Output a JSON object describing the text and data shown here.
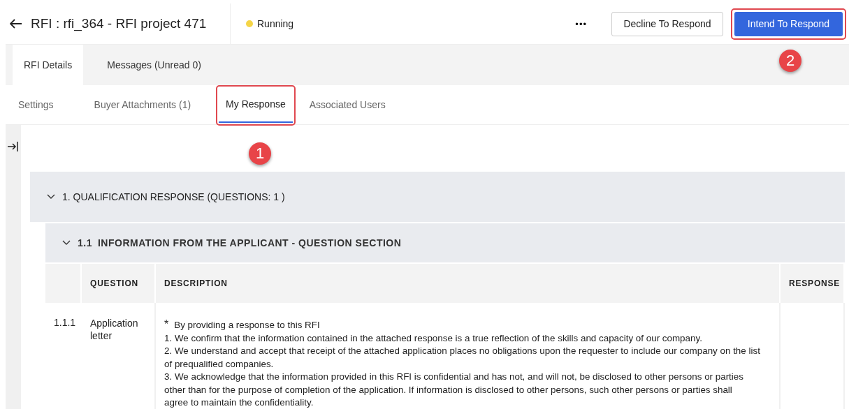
{
  "header": {
    "title": "RFI : rfi_364 - RFI project 471",
    "status": {
      "label": "Running",
      "color": "#f5d547"
    },
    "more": "•••",
    "buttons": [
      {
        "label": "Decline To Respond",
        "kind": "secondary",
        "highlighted": false
      },
      {
        "label": "Intend To Respond",
        "kind": "primary",
        "highlighted": true
      }
    ]
  },
  "tabs": [
    {
      "label": "RFI Details",
      "selected": true
    },
    {
      "label": "Messages (Unread 0)",
      "selected": false
    }
  ],
  "subtabs": [
    {
      "label": "Settings",
      "selected": false,
      "highlighted": false
    },
    {
      "label": "Buyer Attachments (1)",
      "selected": false,
      "highlighted": false
    },
    {
      "label": "My Response",
      "selected": true,
      "highlighted": true
    },
    {
      "label": "Associated Users",
      "selected": false,
      "highlighted": false
    }
  ],
  "callouts": [
    "1",
    "2"
  ],
  "section": {
    "title": "1. QUALIFICATION RESPONSE (QUESTIONS: 1 )",
    "expanded": true,
    "subsection": {
      "number": "1.1",
      "title": "INFORMATION FROM THE APPLICANT - QUESTION SECTION",
      "expanded": true,
      "columns": [
        "QUESTION",
        "DESCRIPTION",
        "RESPONSE"
      ],
      "rows": [
        {
          "number": "1.1.1",
          "question": "Application letter",
          "required": "*",
          "lead": "By providing a response to this RFI",
          "lines": [
            "1. We confirm that the information contained in the attached response is a true reflection of the skills and capacity of our company.",
            "2. We understand and accept that receipt of the attached application places no obligations upon the requester to include our company on the list",
            "of prequalified companies.",
            "3. We acknowledge that the information provided in this RFI is confidential and has not, and will not, be disclosed to other persons or parties",
            "other than for the purpose of completion of the application. If information is disclosed to other persons, such other persons or parties shall",
            "agree to maintain the confidentiality."
          ],
          "response": ""
        }
      ]
    }
  }
}
